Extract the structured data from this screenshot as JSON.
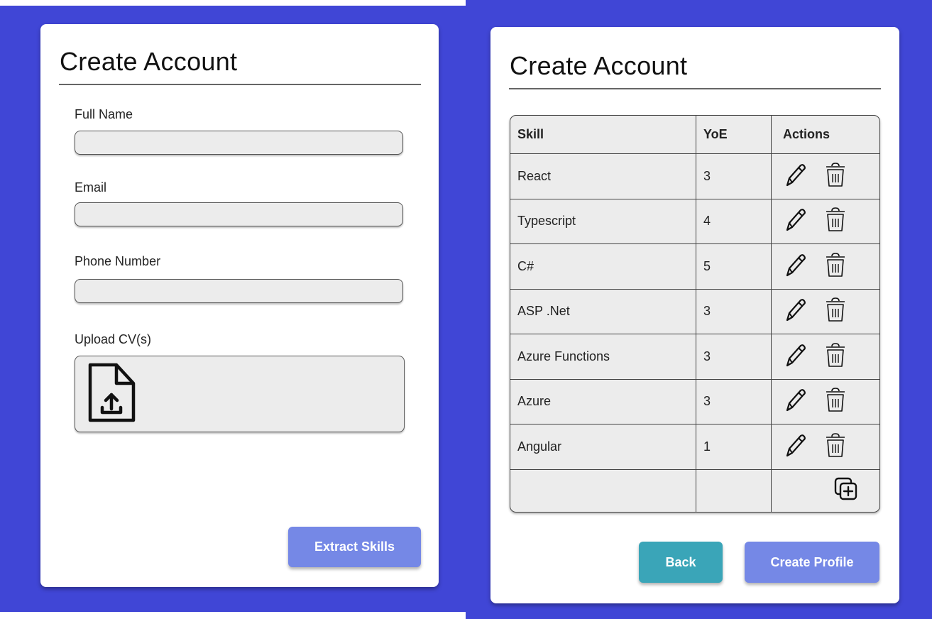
{
  "left_form": {
    "title": "Create Account",
    "fields": [
      {
        "label": "Full Name",
        "value": "",
        "placeholder": ""
      },
      {
        "label": "Email",
        "value": "",
        "placeholder": ""
      },
      {
        "label": "Phone Number",
        "value": "",
        "placeholder": ""
      }
    ],
    "upload_label": "Upload CV(s)",
    "upload_icon": "file-upload-icon",
    "extract_button": "Extract Skills"
  },
  "right_form": {
    "title": "Create Account",
    "table": {
      "headers": [
        "Skill",
        "YoE",
        "Actions"
      ],
      "rows": [
        {
          "skill": "React",
          "yoe": "3"
        },
        {
          "skill": "Typescript",
          "yoe": "4"
        },
        {
          "skill": "C#",
          "yoe": "5"
        },
        {
          "skill": "ASP .Net",
          "yoe": "3"
        },
        {
          "skill": "Azure Functions",
          "yoe": "3"
        },
        {
          "skill": "Azure",
          "yoe": "3"
        },
        {
          "skill": "Angular",
          "yoe": "1"
        }
      ],
      "action_icons": [
        "pencil-icon",
        "trash-icon"
      ],
      "add_icon": "add-row-icon"
    },
    "back_button": "Back",
    "create_button": "Create Profile"
  },
  "colors": {
    "background": "#4046d6",
    "primary_button": "#7588e6",
    "back_button": "#3aa5b8",
    "input_fill": "#ececec"
  }
}
